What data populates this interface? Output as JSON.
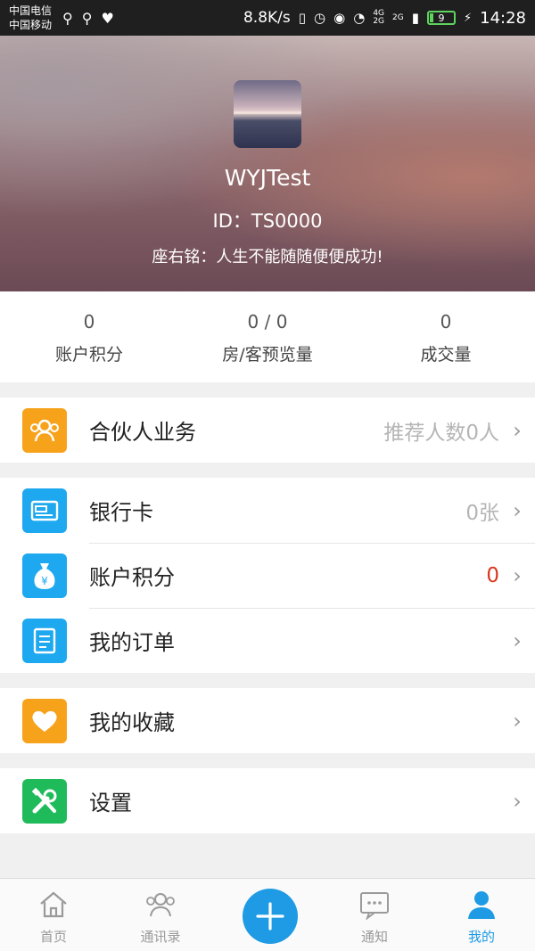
{
  "status_bar": {
    "carrier1": "中国电信",
    "carrier2": "中国移动",
    "speed": "8.8K/s",
    "net1": "4G",
    "net2": "2G",
    "net3": "2G",
    "battery": "9",
    "time": "14:28"
  },
  "profile": {
    "username": "WYJTest",
    "id_text": "ID：TS0000",
    "motto": "座右铭：人生不能随随便便成功!"
  },
  "stats": [
    {
      "value": "0",
      "label": "账户积分"
    },
    {
      "value": "0 / 0",
      "label": "房/客预览量"
    },
    {
      "value": "0",
      "label": "成交量"
    }
  ],
  "menu": {
    "partner": {
      "label": "合伙人业务",
      "value": "推荐人数0人"
    },
    "bank_card": {
      "label": "银行卡",
      "value": "0张"
    },
    "points": {
      "label": "账户积分",
      "value": "0"
    },
    "orders": {
      "label": "我的订单",
      "value": ""
    },
    "favorites": {
      "label": "我的收藏",
      "value": ""
    },
    "settings": {
      "label": "设置",
      "value": ""
    }
  },
  "bottom_nav": [
    {
      "label": "首页"
    },
    {
      "label": "通讯录"
    },
    {
      "label": "通知"
    },
    {
      "label": "我的"
    }
  ],
  "colors": {
    "accent": "#1e9be4",
    "orange_icon": "#f7a21b",
    "blue_icon": "#1da8f0",
    "green_icon": "#1fbb5a",
    "red_value": "#d9381e"
  }
}
